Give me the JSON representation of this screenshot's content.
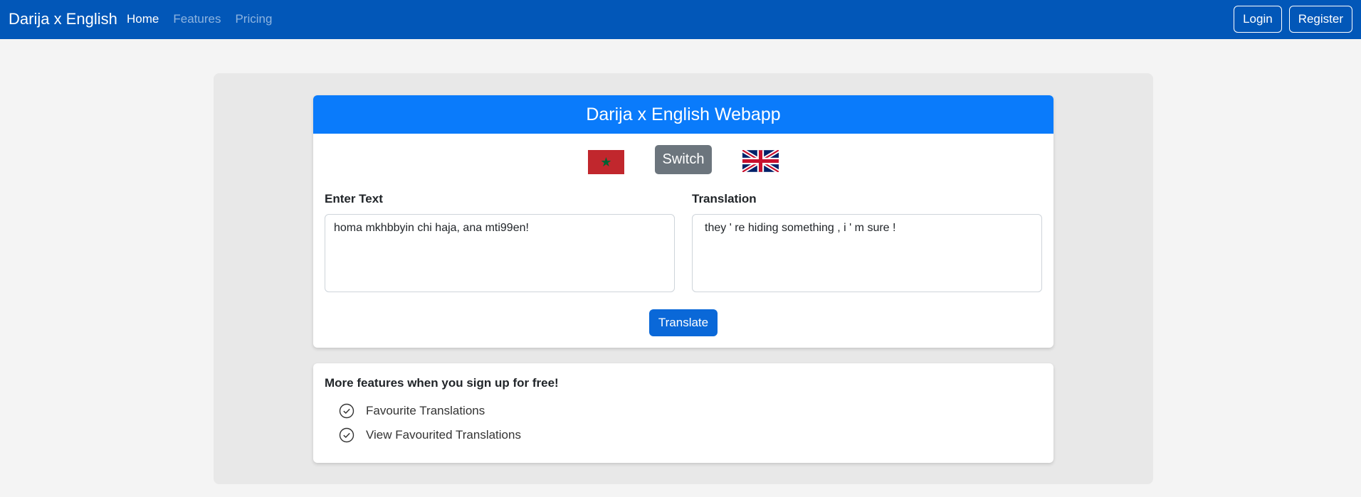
{
  "navbar": {
    "brand": "Darija x English",
    "links": [
      "Home",
      "Features",
      "Pricing"
    ],
    "login": "Login",
    "register": "Register"
  },
  "translator": {
    "title": "Darija x English Webapp",
    "switch_label": "Switch",
    "source_flag": "morocco-flag-icon",
    "target_flag": "uk-flag-icon",
    "input_label": "Enter Text",
    "input_value": "homa mkhbbyin chi haja, ana mti99en!",
    "output_label": "Translation",
    "output_value": "they ' re hiding something , i ' m sure !",
    "translate_label": "Translate"
  },
  "features": {
    "title": "More features when you sign up for free!",
    "items": [
      "Favourite Translations",
      "View Favourited Translations"
    ],
    "item_icon": "check-circle-icon"
  },
  "colors": {
    "navbar": "#0257b8",
    "header": "#0a7bfb",
    "switch": "#6c757d",
    "translate": "#0a68d8"
  }
}
